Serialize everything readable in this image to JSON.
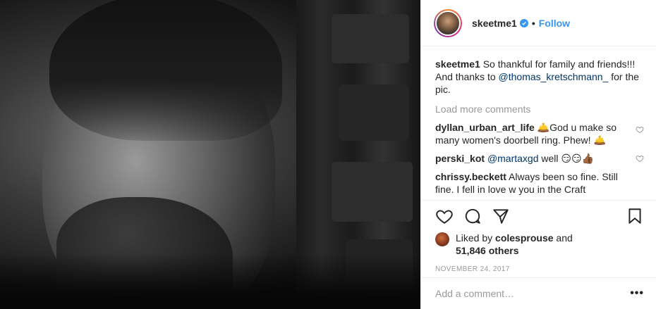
{
  "post": {
    "author": "skeetme1",
    "follow_label": "Follow",
    "dot": "•",
    "caption_user": "skeetme1",
    "caption_text_1": "So thankful for family and friends!!! And thanks to",
    "caption_mention": "@thomas_kretschmann_",
    "caption_text_2": "for the pic."
  },
  "load_more": "Load more comments",
  "comments": [
    {
      "user": "dyllan_urban_art_life",
      "text": "🛎️God u make so many women's doorbell ring. Phew! 🛎️"
    },
    {
      "user": "perski_kot",
      "mention": "@martaxgd",
      "text": "well 😏😏👍🏾"
    },
    {
      "user": "chrissy.beckett",
      "text": "Always been so fine. Still fine. I fell in love w you in the Craft"
    }
  ],
  "likes": {
    "prefix": "Liked by",
    "liker": "colesprouse",
    "conj": "and",
    "others": "51,846 others"
  },
  "date": "NOVEMBER 24, 2017",
  "add_comment": {
    "placeholder": "Add a comment…"
  },
  "more_label": "•••",
  "colors": {
    "accent": "#3897f0",
    "mention": "#003569",
    "muted": "#999999",
    "text": "#262626"
  },
  "icons": [
    "heart-icon",
    "comment-icon",
    "share-icon",
    "bookmark-icon",
    "verified-badge-icon"
  ]
}
